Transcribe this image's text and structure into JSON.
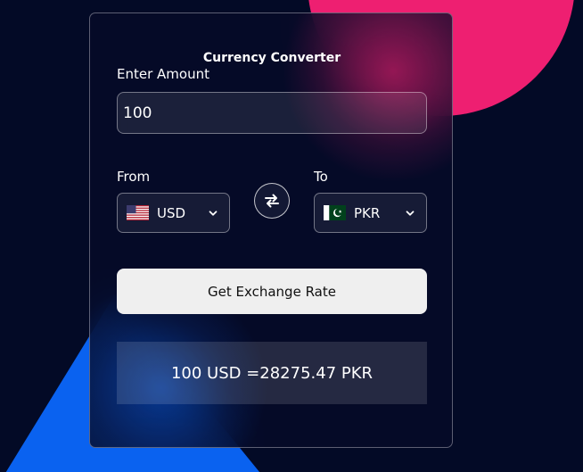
{
  "converter": {
    "title": "Currency Converter",
    "amount_label": "Enter Amount",
    "amount_value": "100",
    "from_label": "From",
    "to_label": "To",
    "from_currency": {
      "code": "USD",
      "flag": "us-flag-icon"
    },
    "to_currency": {
      "code": "PKR",
      "flag": "pk-flag-icon"
    },
    "button_label": "Get Exchange Rate",
    "result_text": "100 USD =28275.47 PKR"
  },
  "colors": {
    "background": "#030a26",
    "pink_accent": "#ee1f71",
    "blue_accent": "#0a62f0",
    "button_bg": "#efefef"
  }
}
